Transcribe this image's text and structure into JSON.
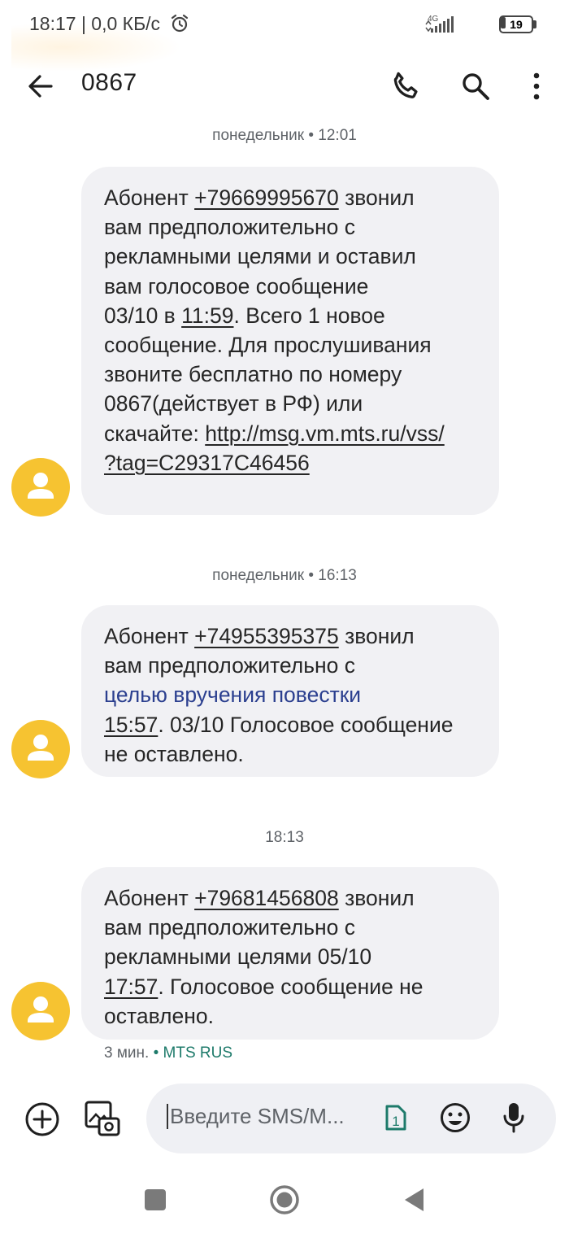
{
  "status_bar": {
    "time_speed": "18:17 | 0,0 КБ/с",
    "network_label": "4G",
    "battery_level": "19",
    "battery_fraction": 0.19
  },
  "app_bar": {
    "title": "0867",
    "back_icon": "arrow-back-icon",
    "call_icon": "phone-icon",
    "search_icon": "search-icon",
    "more_icon": "more-vert-icon"
  },
  "messages": [
    {
      "timestamp": "понедельник • 12:01",
      "parts": [
        {
          "text": "Абонент "
        },
        {
          "text": "+79669995670",
          "link": true
        },
        {
          "text": " звонил\nвам предположительно с\nрекламными целями и оставил\nвам голосовое сообщение\n03/10 в "
        },
        {
          "text": "11:59",
          "link": true
        },
        {
          "text": ". Всего 1 новое\nсообщение. Для прослушивания\nзвоните бесплатно по номеру\n0867(действует в РФ) или\nскачайте: "
        },
        {
          "text": "http://msg.vm.mts.ru/vss/\n?tag=C29317C46456",
          "link": true
        }
      ]
    },
    {
      "timestamp": "понедельник • 16:13",
      "parts": [
        {
          "text": "Абонент "
        },
        {
          "text": "+74955395375",
          "link": true
        },
        {
          "text": " звонил\nвам предположительно с\n"
        },
        {
          "text": "целью вручения повестки",
          "highlight": true
        },
        {
          "text": "\n"
        },
        {
          "text": "15:57",
          "link": true
        },
        {
          "text": ". 03/10 Голосовое сообщение\nне оставлено."
        }
      ]
    },
    {
      "timestamp": "18:13",
      "parts": [
        {
          "text": "Абонент "
        },
        {
          "text": "+79681456808",
          "link": true
        },
        {
          "text": " звонил\nвам предположительно с\nрекламными целями 05/10\n"
        },
        {
          "text": "17:57",
          "link": true
        },
        {
          "text": ". Голосовое сообщение не\nоставлено."
        }
      ]
    }
  ],
  "last_meta": {
    "age": "3 мин.",
    "sim": "• MTS RUS"
  },
  "compose": {
    "placeholder": "Введите SMS/M...",
    "sim_number": "1",
    "add_icon": "add-circle-icon",
    "gallery_icon": "gallery-camera-icon",
    "emoji_icon": "emoji-icon",
    "mic_icon": "mic-icon"
  },
  "nav_bar": {
    "recent_icon": "recents-square-icon",
    "home_icon": "home-circle-icon",
    "back_icon": "back-triangle-icon"
  },
  "colors": {
    "avatar": "#f6c331",
    "bubble": "#f1f1f4",
    "sim_accent": "#1d7a6a",
    "highlight_text": "#2b3f8f"
  }
}
